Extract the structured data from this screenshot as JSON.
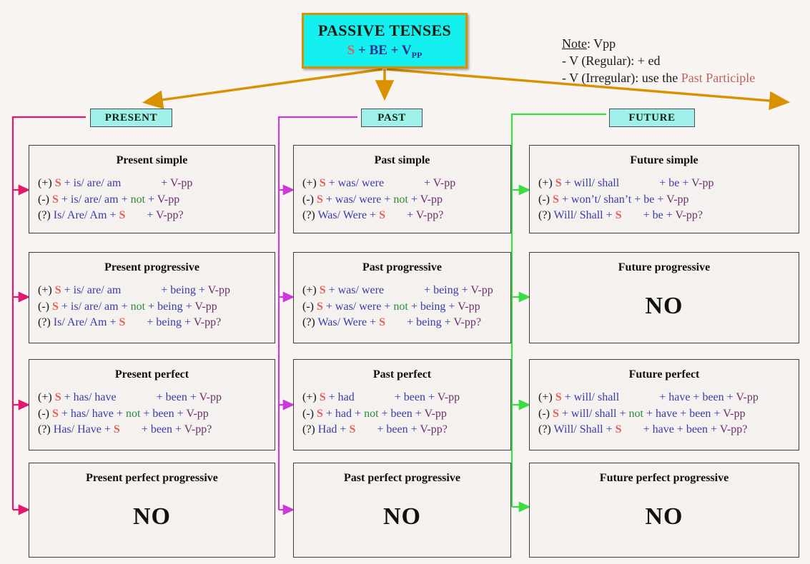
{
  "title": {
    "main": "PASSIVE TENSES",
    "formula_s": "S",
    "formula_plus1": "+",
    "formula_be": "BE",
    "formula_plus2": "+",
    "formula_v": "V",
    "formula_pp": "PP"
  },
  "note": {
    "heading_label": "Note",
    "heading_rest": ": Vpp",
    "line1": "- V (Regular):  + ed",
    "line2_prefix": "- V (Irregular): use the ",
    "line2_highlight": "Past Participle"
  },
  "columns": [
    {
      "header": "PRESENT",
      "wire_color": "#e0196e"
    },
    {
      "header": "PAST",
      "wire_color": "#c93bd6"
    },
    {
      "header": "FUTURE",
      "wire_color": "#3bdb44"
    }
  ],
  "colors": {
    "subject": "#e0605c",
    "auxiliary": "#3b3ba8",
    "negation": "#2e8b3e",
    "participle": "#6b2f6b",
    "title_fill": "#14f0f0",
    "title_border": "#d99100",
    "header_fill": "#9ff0e8",
    "arrow_gold": "#d99100",
    "present_wire": "#e0196e",
    "past_wire": "#c93bd6",
    "future_wire": "#3bdb44",
    "no_text": "#111111"
  },
  "cards": [
    {
      "id": "present-simple",
      "title": "Present simple",
      "no": null,
      "rows": [
        {
          "marker": "(+)",
          "s": "S",
          "plus1": "+",
          "aux": "is/ are/ am",
          "not": null,
          "gap": "big",
          "tail_plus": "+",
          "tail": "V-pp"
        },
        {
          "marker": "(-)",
          "s": "S",
          "plus1": "+",
          "aux": "is/ are/ am",
          "not": "not",
          "gap": "none",
          "tail_plus": "+",
          "tail": "V-pp"
        },
        {
          "marker": "(?)",
          "s": null,
          "plus1": null,
          "aux": "Is/ Are/ Am",
          "inv_s": "S",
          "not": null,
          "gap": "mid",
          "tail_plus": "+",
          "tail": "V-pp?"
        }
      ]
    },
    {
      "id": "present-progressive",
      "title": "Present progressive",
      "no": null,
      "rows": [
        {
          "marker": "(+)",
          "s": "S",
          "plus1": "+",
          "aux": "is/ are/ am",
          "not": null,
          "gap": "big",
          "mid_plus": "+",
          "mid": "being",
          "tail_plus": "+",
          "tail": "V-pp"
        },
        {
          "marker": "(-)",
          "s": "S",
          "plus1": "+",
          "aux": "is/ are/ am",
          "not": "not",
          "gap": "none",
          "mid_plus": "+",
          "mid": "being",
          "tail_plus": "+",
          "tail": "V-pp"
        },
        {
          "marker": "(?)",
          "s": null,
          "plus1": null,
          "aux": "Is/ Are/ Am",
          "inv_s": "S",
          "not": null,
          "gap": "mid",
          "mid_plus": "+",
          "mid": "being",
          "tail_plus": "+",
          "tail": "V-pp?"
        }
      ]
    },
    {
      "id": "present-perfect",
      "title": "Present perfect",
      "no": null,
      "rows": [
        {
          "marker": "(+)",
          "s": "S",
          "plus1": "+",
          "aux": "has/ have",
          "not": null,
          "gap": "big",
          "mid_plus": "+",
          "mid": "been",
          "tail_plus": "+",
          "tail": "V-pp"
        },
        {
          "marker": "(-)",
          "s": "S",
          "plus1": "+",
          "aux": "has/ have",
          "not": "not",
          "gap": "none",
          "mid_plus": "+",
          "mid": "been",
          "tail_plus": "+",
          "tail": "V-pp"
        },
        {
          "marker": "(?)",
          "s": null,
          "plus1": null,
          "aux": "Has/ Have",
          "inv_s": "S",
          "not": null,
          "gap": "mid",
          "mid_plus": "+",
          "mid": "been",
          "tail_plus": "+",
          "tail": "V-pp?"
        }
      ]
    },
    {
      "id": "present-perfect-progressive",
      "title": "Present perfect progressive",
      "no": "NO",
      "rows": []
    },
    {
      "id": "past-simple",
      "title": "Past simple",
      "no": null,
      "rows": [
        {
          "marker": "(+)",
          "s": "S",
          "plus1": "+",
          "aux": "was/ were",
          "not": null,
          "gap": "big",
          "tail_plus": "+",
          "tail": "V-pp"
        },
        {
          "marker": "(-)",
          "s": "S",
          "plus1": "+",
          "aux": "was/ were",
          "not": "not",
          "gap": "none",
          "tail_plus": "+",
          "tail": "V-pp"
        },
        {
          "marker": "(?)",
          "s": null,
          "plus1": null,
          "aux": "Was/ Were",
          "inv_s": "S",
          "not": null,
          "gap": "mid",
          "tail_plus": "+",
          "tail": "V-pp?"
        }
      ]
    },
    {
      "id": "past-progressive",
      "title": "Past progressive",
      "no": null,
      "rows": [
        {
          "marker": "(+)",
          "s": "S",
          "plus1": "+",
          "aux": "was/ were",
          "not": null,
          "gap": "big",
          "mid_plus": "+",
          "mid": "being",
          "tail_plus": "+",
          "tail": "V-pp"
        },
        {
          "marker": "(-)",
          "s": "S",
          "plus1": "+",
          "aux": "was/ were",
          "not": "not",
          "gap": "none",
          "mid_plus": "+",
          "mid": "being",
          "tail_plus": "+",
          "tail": "V-pp"
        },
        {
          "marker": "(?)",
          "s": null,
          "plus1": null,
          "aux": "Was/ Were",
          "inv_s": "S",
          "not": null,
          "gap": "mid",
          "mid_plus": "+",
          "mid": "being",
          "tail_plus": "+",
          "tail": "V-pp?"
        }
      ]
    },
    {
      "id": "past-perfect",
      "title": "Past perfect",
      "no": null,
      "rows": [
        {
          "marker": "(+)",
          "s": "S",
          "plus1": "+",
          "aux": "had",
          "not": null,
          "gap": "big",
          "mid_plus": "+",
          "mid": "been",
          "tail_plus": "+",
          "tail": "V-pp"
        },
        {
          "marker": "(-)",
          "s": "S",
          "plus1": "+",
          "aux": "had",
          "not": "not",
          "gap": "none",
          "mid_plus": "+",
          "mid": "been",
          "tail_plus": "+",
          "tail": "V-pp"
        },
        {
          "marker": "(?)",
          "s": null,
          "plus1": null,
          "aux": "Had",
          "inv_s": "S",
          "not": null,
          "gap": "mid",
          "mid_plus": "+",
          "mid": "been",
          "tail_plus": "+",
          "tail": "V-pp?"
        }
      ]
    },
    {
      "id": "past-perfect-progressive",
      "title": "Past perfect progressive",
      "no": "NO",
      "rows": []
    },
    {
      "id": "future-simple",
      "title": "Future simple",
      "no": null,
      "rows": [
        {
          "marker": "(+)",
          "s": "S",
          "plus1": "+",
          "aux": "will/ shall",
          "not": null,
          "gap": "big",
          "mid_plus": "+",
          "mid": "be",
          "tail_plus": "+",
          "tail": "V-pp"
        },
        {
          "marker": "(-)",
          "s": "S",
          "plus1": "+",
          "aux": "won’t/ shan’t",
          "not": null,
          "gap": "none",
          "mid_plus": "+",
          "mid": "be",
          "tail_plus": "+",
          "tail": "V-pp"
        },
        {
          "marker": "(?)",
          "s": null,
          "plus1": null,
          "aux": "Will/ Shall",
          "inv_s": "S",
          "not": null,
          "gap": "mid",
          "mid_plus": "+",
          "mid": "be",
          "tail_plus": "+",
          "tail": "V-pp?"
        }
      ]
    },
    {
      "id": "future-progressive",
      "title": "Future progressive",
      "no": "NO",
      "rows": []
    },
    {
      "id": "future-perfect",
      "title": "Future perfect",
      "no": null,
      "rows": [
        {
          "marker": "(+)",
          "s": "S",
          "plus1": "+",
          "aux": "will/ shall",
          "not": null,
          "gap": "big",
          "mid_plus": "+",
          "mid": "have + been",
          "tail_plus": "+",
          "tail": "V-pp"
        },
        {
          "marker": "(-)",
          "s": "S",
          "plus1": "+",
          "aux": "will/ shall",
          "not": "not",
          "gap": "none",
          "mid_plus": "+",
          "mid": "have + been",
          "tail_plus": "+",
          "tail": "V-pp"
        },
        {
          "marker": "(?)",
          "s": null,
          "plus1": null,
          "aux": "Will/ Shall",
          "inv_s": "S",
          "not": null,
          "gap": "mid",
          "mid_plus": "+",
          "mid": "have + been",
          "tail_plus": "+",
          "tail": "V-pp?"
        }
      ]
    },
    {
      "id": "future-perfect-progressive",
      "title": "Future perfect progressive",
      "no": "NO",
      "rows": []
    }
  ]
}
